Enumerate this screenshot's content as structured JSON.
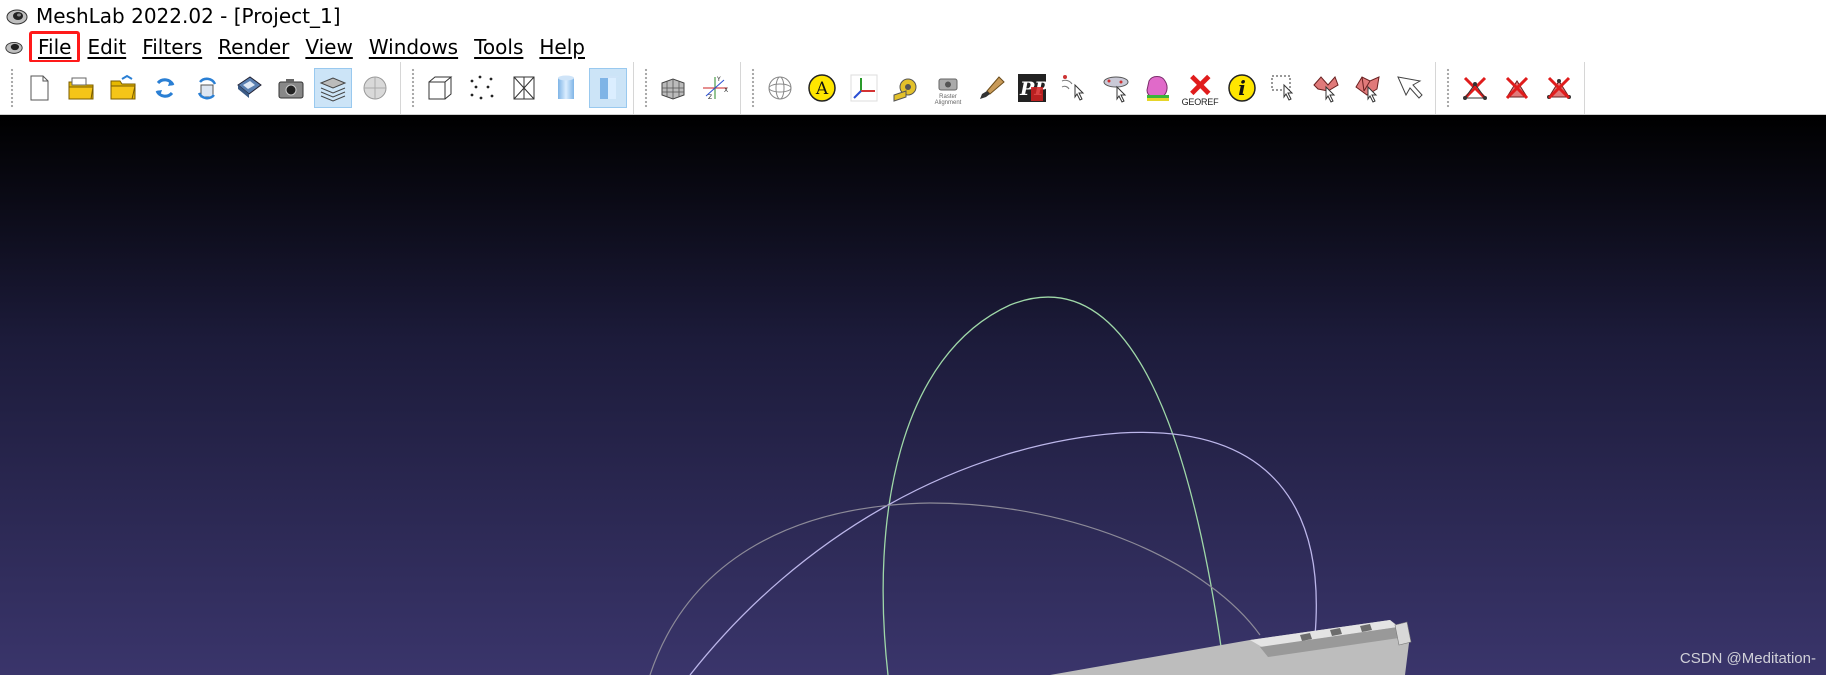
{
  "window": {
    "title": "MeshLab 2022.02 - [Project_1]"
  },
  "menu": {
    "items": [
      {
        "label": "File",
        "highlighted": true
      },
      {
        "label": "Edit"
      },
      {
        "label": "Filters"
      },
      {
        "label": "Render"
      },
      {
        "label": "View"
      },
      {
        "label": "Windows"
      },
      {
        "label": "Tools"
      },
      {
        "label": "Help"
      }
    ],
    "highlight_color": "#ff1a1a"
  },
  "toolbar": {
    "icons": [
      "new-project-icon",
      "open-project-icon",
      "import-mesh-icon",
      "reload-icon",
      "reload-all-icon",
      "save-icon",
      "snapshot-icon",
      "layers-icon",
      "raster-icon",
      "bounding-box-icon",
      "points-icon",
      "wireframe-icon",
      "flat-shading-icon",
      "smooth-shading-icon",
      "grid-icon",
      "axes-icon",
      "trackball-icon",
      "annotation-icon",
      "axis-frame-icon",
      "measure-tape-icon",
      "raster-alignment-icon",
      "paint-brush-icon",
      "pickpoints-icon",
      "select-vertices-icon",
      "align-icon",
      "color-paint-icon",
      "georef-icon",
      "info-icon",
      "select-faces-rect-icon",
      "select-connected-icon",
      "select-mesh-icon",
      "select-cursor-icon",
      "delete-vertices-icon",
      "delete-faces-icon",
      "delete-both-icon"
    ],
    "annotation_letter": "A",
    "info_letter": "i",
    "pp_letters": "PP",
    "georef_label": "GEOREF",
    "raster_alignment_label": "Raster Alignment"
  },
  "viewport": {
    "background_top": "#000000",
    "background_bottom": "#3a356b"
  },
  "watermark": "CSDN @Meditation-"
}
